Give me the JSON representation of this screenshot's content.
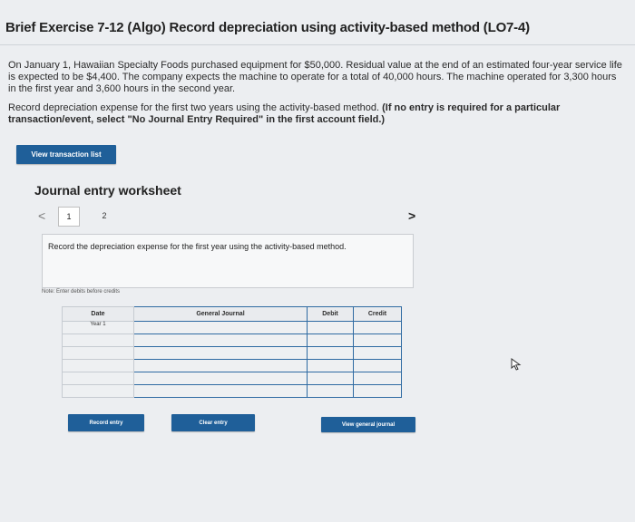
{
  "header": {
    "title": "Brief Exercise 7-12 (Algo) Record depreciation using activity-based method (LO7-4)"
  },
  "problem": {
    "paragraph1": "On January 1, Hawaiian Specialty Foods purchased equipment for $50,000. Residual value at the end of an estimated four-year service life is expected to be $4,400. The company expects the machine to operate for a total of 40,000 hours. The machine operated for 3,300 hours in the first year and 3,600 hours in the second year.",
    "instruction_plain": "Record depreciation expense for the first two years using the activity-based method.",
    "instruction_bold": "(If no entry is required for a particular transaction/event, select \"No Journal Entry Required\" in the first account field.)"
  },
  "buttons": {
    "view_transaction_list": "View transaction list",
    "record_entry": "Record entry",
    "clear_entry": "Clear entry",
    "view_general_journal": "View general journal"
  },
  "worksheet": {
    "title": "Journal entry worksheet",
    "nav_prev": "<",
    "nav_next": ">",
    "tabs": [
      "1",
      "2"
    ],
    "prompt": "Record the depreciation expense for the first year using the activity-based method.",
    "note": "Note: Enter debits before credits",
    "columns": {
      "date": "Date",
      "journal": "General Journal",
      "debit": "Debit",
      "credit": "Credit"
    },
    "rows": [
      {
        "date": "Year 1",
        "account": "",
        "debit": "",
        "credit": ""
      },
      {
        "date": "",
        "account": "",
        "debit": "",
        "credit": ""
      },
      {
        "date": "",
        "account": "",
        "debit": "",
        "credit": ""
      },
      {
        "date": "",
        "account": "",
        "debit": "",
        "credit": ""
      },
      {
        "date": "",
        "account": "",
        "debit": "",
        "credit": ""
      },
      {
        "date": "",
        "account": "",
        "debit": "",
        "credit": ""
      }
    ]
  },
  "colors": {
    "button": "#1f5f99",
    "table_border": "#2e6aa2"
  },
  "icons": {
    "cursor": "mouse-pointer-icon"
  }
}
